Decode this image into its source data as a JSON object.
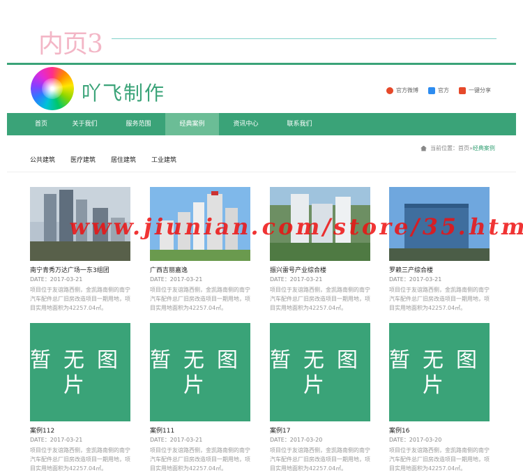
{
  "page_label": "内页3",
  "site_name": "吖飞制作",
  "header_links": [
    {
      "label": "官方微博",
      "icon": "weibo-icon"
    },
    {
      "label": "官方",
      "icon": "qq-icon"
    },
    {
      "label": "一键分享",
      "icon": "share-icon"
    }
  ],
  "nav": [
    {
      "label": "首页"
    },
    {
      "label": "关于我们"
    },
    {
      "label": "服务范围"
    },
    {
      "label": "经典案例",
      "active": true
    },
    {
      "label": "资讯中心"
    },
    {
      "label": "联系我们"
    }
  ],
  "breadcrumb": {
    "prefix": "当前位置：",
    "home": "首页",
    "sep": " » ",
    "current": "经典案例"
  },
  "categories": [
    "公共建筑",
    "医疗建筑",
    "居住建筑",
    "工业建筑"
  ],
  "cases_row1": [
    {
      "title": "南宁青秀万达广场一东3组团",
      "date": "DATE：2017-03-21",
      "desc": "项目位于友谊路西侧，金凯路南侧的南宁汽车配件总厂旧房改造项目一期用地，项目实用地面积为42257.04㎡。"
    },
    {
      "title": "广西吉丽嘉逸",
      "date": "DATE：2017-03-21",
      "desc": "项目位于友谊路西侧，金凯路南侧的南宁汽车配件总厂旧房改造项目一期用地，项目实用地面积为42257.04㎡。"
    },
    {
      "title": "振兴雷号产业综合楼",
      "date": "DATE：2017-03-21",
      "desc": "项目位于友谊路西侧，金凯路南侧的南宁汽车配件总厂旧房改造项目一期用地，项目实用地面积为42257.04㎡。"
    },
    {
      "title": "罗赖三产综合楼",
      "date": "DATE：2017-03-21",
      "desc": "项目位于友谊路西侧，金凯路南侧的南宁汽车配件总厂旧房改造项目一期用地，项目实用地面积为42257.04㎡。"
    }
  ],
  "cases_row2": [
    {
      "title": "案例112",
      "date": "DATE：2017-03-21",
      "desc": "项目位于友谊路西侧，金凯路南侧的南宁汽车配件总厂旧房改造项目一期用地，项目实用地面积为42257.04㎡。",
      "placeholder": "暂无图片"
    },
    {
      "title": "案例111",
      "date": "DATE：2017-03-21",
      "desc": "项目位于友谊路西侧，金凯路南侧的南宁汽车配件总厂旧房改造项目一期用地，项目实用地面积为42257.04㎡。",
      "placeholder": "暂无图片"
    },
    {
      "title": "案例17",
      "date": "DATE：2017-03-20",
      "desc": "项目位于友谊路西侧，金凯路南侧的南宁汽车配件总厂旧房改造项目一期用地，项目实用地面积为42257.04㎡。",
      "placeholder": "暂无图片"
    },
    {
      "title": "案例16",
      "date": "DATE：2017-03-20",
      "desc": "项目位于友谊路西侧，金凯路南侧的南宁汽车配件总厂旧房改造项目一期用地，项目实用地面积为42257.04㎡。",
      "placeholder": "暂无图片"
    }
  ],
  "watermark": "www.jiunian.com/store/35.html",
  "colors": {
    "brand": "#3aa378",
    "nav_active": "#6bbd96",
    "label_pink": "#f3b6c6",
    "watermark": "#ee1111"
  }
}
